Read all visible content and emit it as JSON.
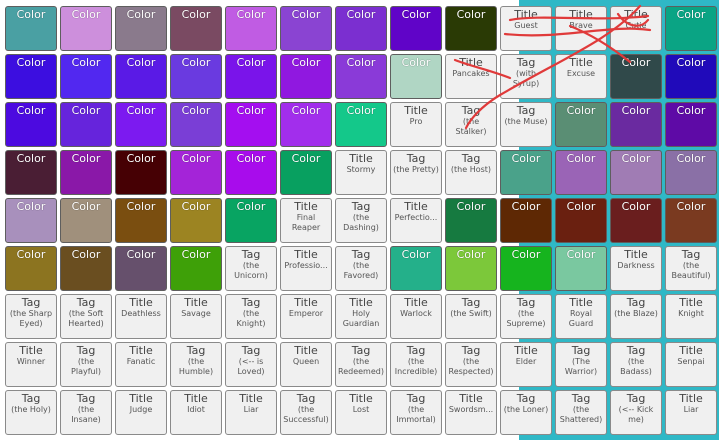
{
  "tiles": [
    {
      "r": 0,
      "c": 0,
      "type": "color",
      "label": "Color",
      "color": "#4aa0a3"
    },
    {
      "r": 0,
      "c": 1,
      "type": "color",
      "label": "Color",
      "color": "#cd8fdc"
    },
    {
      "r": 0,
      "c": 2,
      "type": "color",
      "label": "Color",
      "color": "#8a7a8c"
    },
    {
      "r": 0,
      "c": 3,
      "type": "color",
      "label": "Color",
      "color": "#7a4a62"
    },
    {
      "r": 0,
      "c": 4,
      "type": "color",
      "label": "Color",
      "color": "#c05ce3"
    },
    {
      "r": 0,
      "c": 5,
      "type": "color",
      "label": "Color",
      "color": "#8a44d2"
    },
    {
      "r": 0,
      "c": 6,
      "type": "color",
      "label": "Color",
      "color": "#7b2fd0"
    },
    {
      "r": 0,
      "c": 7,
      "type": "color",
      "label": "Color",
      "color": "#6004c8"
    },
    {
      "r": 0,
      "c": 8,
      "type": "color",
      "label": "Color",
      "color": "#2a3a05"
    },
    {
      "r": 0,
      "c": 9,
      "type": "text",
      "label": "Title",
      "sub": "Guest"
    },
    {
      "r": 0,
      "c": 10,
      "type": "text",
      "label": "Title",
      "sub": "Brave"
    },
    {
      "r": 0,
      "c": 11,
      "type": "text",
      "label": "Title",
      "sub": "Cutie"
    },
    {
      "r": 0,
      "c": 12,
      "type": "color",
      "label": "Color",
      "color": "#0aa484"
    },
    {
      "r": 1,
      "c": 0,
      "type": "color",
      "label": "Color",
      "color": "#3c0ee0"
    },
    {
      "r": 1,
      "c": 1,
      "type": "color",
      "label": "Color",
      "color": "#5228f0"
    },
    {
      "r": 1,
      "c": 2,
      "type": "color",
      "label": "Color",
      "color": "#5a1ae6"
    },
    {
      "r": 1,
      "c": 3,
      "type": "color",
      "label": "Color",
      "color": "#6a3ae0"
    },
    {
      "r": 1,
      "c": 4,
      "type": "color",
      "label": "Color",
      "color": "#7a14ea"
    },
    {
      "r": 1,
      "c": 5,
      "type": "color",
      "label": "Color",
      "color": "#9018e0"
    },
    {
      "r": 1,
      "c": 6,
      "type": "color",
      "label": "Color",
      "color": "#8a3ad8"
    },
    {
      "r": 1,
      "c": 7,
      "type": "color",
      "label": "Color",
      "color": "#b0d6c4"
    },
    {
      "r": 1,
      "c": 8,
      "type": "text",
      "label": "Title",
      "sub": "Pancakes"
    },
    {
      "r": 1,
      "c": 9,
      "type": "text",
      "label": "Tag",
      "sub": "(with\nSyrup)"
    },
    {
      "r": 1,
      "c": 10,
      "type": "text",
      "label": "Title",
      "sub": "Excuse"
    },
    {
      "r": 1,
      "c": 11,
      "type": "color",
      "label": "Color",
      "color": "#30494a"
    },
    {
      "r": 1,
      "c": 12,
      "type": "color",
      "label": "Color",
      "color": "#200aba"
    },
    {
      "r": 2,
      "c": 0,
      "type": "color",
      "label": "Color",
      "color": "#4c0ae0"
    },
    {
      "r": 2,
      "c": 1,
      "type": "color",
      "label": "Color",
      "color": "#6624dc"
    },
    {
      "r": 2,
      "c": 2,
      "type": "color",
      "label": "Color",
      "color": "#7c1af0"
    },
    {
      "r": 2,
      "c": 3,
      "type": "color",
      "label": "Color",
      "color": "#7a3ed6"
    },
    {
      "r": 2,
      "c": 4,
      "type": "color",
      "label": "Color",
      "color": "#a40ef0"
    },
    {
      "r": 2,
      "c": 5,
      "type": "color",
      "label": "Color",
      "color": "#a22eec"
    },
    {
      "r": 2,
      "c": 6,
      "type": "color",
      "label": "Color",
      "color": "#14c88a"
    },
    {
      "r": 2,
      "c": 7,
      "type": "text",
      "label": "Title",
      "sub": "Pro"
    },
    {
      "r": 2,
      "c": 8,
      "type": "text",
      "label": "Tag",
      "sub": "(the\nStalker)"
    },
    {
      "r": 2,
      "c": 9,
      "type": "text",
      "label": "Tag",
      "sub": "(the Muse)"
    },
    {
      "r": 2,
      "c": 10,
      "type": "color",
      "label": "Color",
      "color": "#5a8e74"
    },
    {
      "r": 2,
      "c": 11,
      "type": "color",
      "label": "Color",
      "color": "#6a2aa0"
    },
    {
      "r": 2,
      "c": 12,
      "type": "color",
      "label": "Color",
      "color": "#5e0aa6"
    },
    {
      "r": 3,
      "c": 0,
      "type": "color",
      "label": "Color",
      "color": "#4a1e34"
    },
    {
      "r": 3,
      "c": 1,
      "type": "color",
      "label": "Color",
      "color": "#8a18a8"
    },
    {
      "r": 3,
      "c": 2,
      "type": "color",
      "label": "Color",
      "color": "#460004"
    },
    {
      "r": 3,
      "c": 3,
      "type": "color",
      "label": "Color",
      "color": "#a424d8"
    },
    {
      "r": 3,
      "c": 4,
      "type": "color",
      "label": "Color",
      "color": "#a80cec"
    },
    {
      "r": 3,
      "c": 5,
      "type": "color",
      "label": "Color",
      "color": "#08a060"
    },
    {
      "r": 3,
      "c": 6,
      "type": "text",
      "label": "Title",
      "sub": "Stormy"
    },
    {
      "r": 3,
      "c": 7,
      "type": "text",
      "label": "Tag",
      "sub": "(the Pretty)"
    },
    {
      "r": 3,
      "c": 8,
      "type": "text",
      "label": "Tag",
      "sub": "(the Host)"
    },
    {
      "r": 3,
      "c": 9,
      "type": "color",
      "label": "Color",
      "color": "#4aa28a"
    },
    {
      "r": 3,
      "c": 10,
      "type": "color",
      "label": "Color",
      "color": "#9a64b6"
    },
    {
      "r": 3,
      "c": 11,
      "type": "color",
      "label": "Color",
      "color": "#a07cb4"
    },
    {
      "r": 3,
      "c": 12,
      "type": "color",
      "label": "Color",
      "color": "#8a70a6"
    },
    {
      "r": 4,
      "c": 0,
      "type": "color",
      "label": "Color",
      "color": "#a890bc"
    },
    {
      "r": 4,
      "c": 1,
      "type": "color",
      "label": "Color",
      "color": "#a0907c"
    },
    {
      "r": 4,
      "c": 2,
      "type": "color",
      "label": "Color",
      "color": "#7a4e10"
    },
    {
      "r": 4,
      "c": 3,
      "type": "color",
      "label": "Color",
      "color": "#9c8422"
    },
    {
      "r": 4,
      "c": 4,
      "type": "color",
      "label": "Color",
      "color": "#08a462"
    },
    {
      "r": 4,
      "c": 5,
      "type": "text",
      "label": "Title",
      "sub": "Final\nReaper"
    },
    {
      "r": 4,
      "c": 6,
      "type": "text",
      "label": "Tag",
      "sub": "(the\nDashing)"
    },
    {
      "r": 4,
      "c": 7,
      "type": "text",
      "label": "Title",
      "sub": "Perfectio..."
    },
    {
      "r": 4,
      "c": 8,
      "type": "color",
      "label": "Color",
      "color": "#167a40"
    },
    {
      "r": 4,
      "c": 9,
      "type": "color",
      "label": "Color",
      "color": "#5e2804"
    },
    {
      "r": 4,
      "c": 10,
      "type": "color",
      "label": "Color",
      "color": "#6a2010"
    },
    {
      "r": 4,
      "c": 11,
      "type": "color",
      "label": "Color",
      "color": "#6a1e1e"
    },
    {
      "r": 4,
      "c": 12,
      "type": "color",
      "label": "Color",
      "color": "#7a3a20"
    },
    {
      "r": 5,
      "c": 0,
      "type": "color",
      "label": "Color",
      "color": "#8c7420"
    },
    {
      "r": 5,
      "c": 1,
      "type": "color",
      "label": "Color",
      "color": "#6a4e20"
    },
    {
      "r": 5,
      "c": 2,
      "type": "color",
      "label": "Color",
      "color": "#66506c"
    },
    {
      "r": 5,
      "c": 3,
      "type": "color",
      "label": "Color",
      "color": "#3ea008"
    },
    {
      "r": 5,
      "c": 4,
      "type": "text",
      "label": "Tag",
      "sub": "(the\nUnicorn)"
    },
    {
      "r": 5,
      "c": 5,
      "type": "text",
      "label": "Title",
      "sub": "Professio..."
    },
    {
      "r": 5,
      "c": 6,
      "type": "text",
      "label": "Tag",
      "sub": "(the\nFavored)"
    },
    {
      "r": 5,
      "c": 7,
      "type": "color",
      "label": "Color",
      "color": "#24b08a"
    },
    {
      "r": 5,
      "c": 8,
      "type": "color",
      "label": "Color",
      "color": "#7cc83a"
    },
    {
      "r": 5,
      "c": 9,
      "type": "color",
      "label": "Color",
      "color": "#16b41e"
    },
    {
      "r": 5,
      "c": 10,
      "type": "color",
      "label": "Color",
      "color": "#7ac8a0"
    },
    {
      "r": 5,
      "c": 11,
      "type": "text",
      "label": "Title",
      "sub": "Darkness"
    },
    {
      "r": 5,
      "c": 12,
      "type": "text",
      "label": "Tag",
      "sub": "(the\nBeautiful)"
    },
    {
      "r": 6,
      "c": 0,
      "type": "text",
      "label": "Tag",
      "sub": "(the Sharp\nEyed)"
    },
    {
      "r": 6,
      "c": 1,
      "type": "text",
      "label": "Tag",
      "sub": "(the Soft\nHearted)"
    },
    {
      "r": 6,
      "c": 2,
      "type": "text",
      "label": "Title",
      "sub": "Deathless"
    },
    {
      "r": 6,
      "c": 3,
      "type": "text",
      "label": "Title",
      "sub": "Savage"
    },
    {
      "r": 6,
      "c": 4,
      "type": "text",
      "label": "Tag",
      "sub": "(the\nKnight)"
    },
    {
      "r": 6,
      "c": 5,
      "type": "text",
      "label": "Title",
      "sub": "Emperor"
    },
    {
      "r": 6,
      "c": 6,
      "type": "text",
      "label": "Title",
      "sub": "Holy\nGuardian"
    },
    {
      "r": 6,
      "c": 7,
      "type": "text",
      "label": "Title",
      "sub": "Warlock"
    },
    {
      "r": 6,
      "c": 8,
      "type": "text",
      "label": "Tag",
      "sub": "(the Swift)"
    },
    {
      "r": 6,
      "c": 9,
      "type": "text",
      "label": "Tag",
      "sub": "(the\nSupreme)"
    },
    {
      "r": 6,
      "c": 10,
      "type": "text",
      "label": "Title",
      "sub": "Royal\nGuard"
    },
    {
      "r": 6,
      "c": 11,
      "type": "text",
      "label": "Tag",
      "sub": "(the Blaze)"
    },
    {
      "r": 6,
      "c": 12,
      "type": "text",
      "label": "Title",
      "sub": "Knight"
    },
    {
      "r": 7,
      "c": 0,
      "type": "text",
      "label": "Title",
      "sub": "Winner"
    },
    {
      "r": 7,
      "c": 1,
      "type": "text",
      "label": "Tag",
      "sub": "(the\nPlayful)"
    },
    {
      "r": 7,
      "c": 2,
      "type": "text",
      "label": "Title",
      "sub": "Fanatic"
    },
    {
      "r": 7,
      "c": 3,
      "type": "text",
      "label": "Tag",
      "sub": "(the\nHumble)"
    },
    {
      "r": 7,
      "c": 4,
      "type": "text",
      "label": "Tag",
      "sub": "(<-- is\nLoved)"
    },
    {
      "r": 7,
      "c": 5,
      "type": "text",
      "label": "Title",
      "sub": "Queen"
    },
    {
      "r": 7,
      "c": 6,
      "type": "text",
      "label": "Tag",
      "sub": "(the\nRedeemed)"
    },
    {
      "r": 7,
      "c": 7,
      "type": "text",
      "label": "Tag",
      "sub": "(the\nIncredible)"
    },
    {
      "r": 7,
      "c": 8,
      "type": "text",
      "label": "Tag",
      "sub": "(the\nRespected)"
    },
    {
      "r": 7,
      "c": 9,
      "type": "text",
      "label": "Title",
      "sub": "Elder"
    },
    {
      "r": 7,
      "c": 10,
      "type": "text",
      "label": "Tag",
      "sub": "(The\nWarrior)"
    },
    {
      "r": 7,
      "c": 11,
      "type": "text",
      "label": "Tag",
      "sub": "(the\nBadass)"
    },
    {
      "r": 7,
      "c": 12,
      "type": "text",
      "label": "Title",
      "sub": "Senpai"
    },
    {
      "r": 8,
      "c": 0,
      "type": "text",
      "label": "Tag",
      "sub": "(the Holy)"
    },
    {
      "r": 8,
      "c": 1,
      "type": "text",
      "label": "Tag",
      "sub": "(the\nInsane)"
    },
    {
      "r": 8,
      "c": 2,
      "type": "text",
      "label": "Title",
      "sub": "Judge"
    },
    {
      "r": 8,
      "c": 3,
      "type": "text",
      "label": "Title",
      "sub": "Idiot"
    },
    {
      "r": 8,
      "c": 4,
      "type": "text",
      "label": "Title",
      "sub": "Liar"
    },
    {
      "r": 8,
      "c": 5,
      "type": "text",
      "label": "Tag",
      "sub": "(the\nSuccessful)"
    },
    {
      "r": 8,
      "c": 6,
      "type": "text",
      "label": "Title",
      "sub": "Lost"
    },
    {
      "r": 8,
      "c": 7,
      "type": "text",
      "label": "Tag",
      "sub": "(the\nImmortal)"
    },
    {
      "r": 8,
      "c": 8,
      "type": "text",
      "label": "Title",
      "sub": "Swordsm..."
    },
    {
      "r": 8,
      "c": 9,
      "type": "text",
      "label": "Tag",
      "sub": "(the Loner)"
    },
    {
      "r": 8,
      "c": 10,
      "type": "text",
      "label": "Tag",
      "sub": "(the\nShattered)"
    },
    {
      "r": 8,
      "c": 11,
      "type": "text",
      "label": "Tag",
      "sub": "(<-- Kick\nme)"
    },
    {
      "r": 8,
      "c": 12,
      "type": "text",
      "label": "Title",
      "sub": "Liar"
    }
  ],
  "annotation_color": "#e03a3a",
  "background_accent": "#2fb8c6"
}
